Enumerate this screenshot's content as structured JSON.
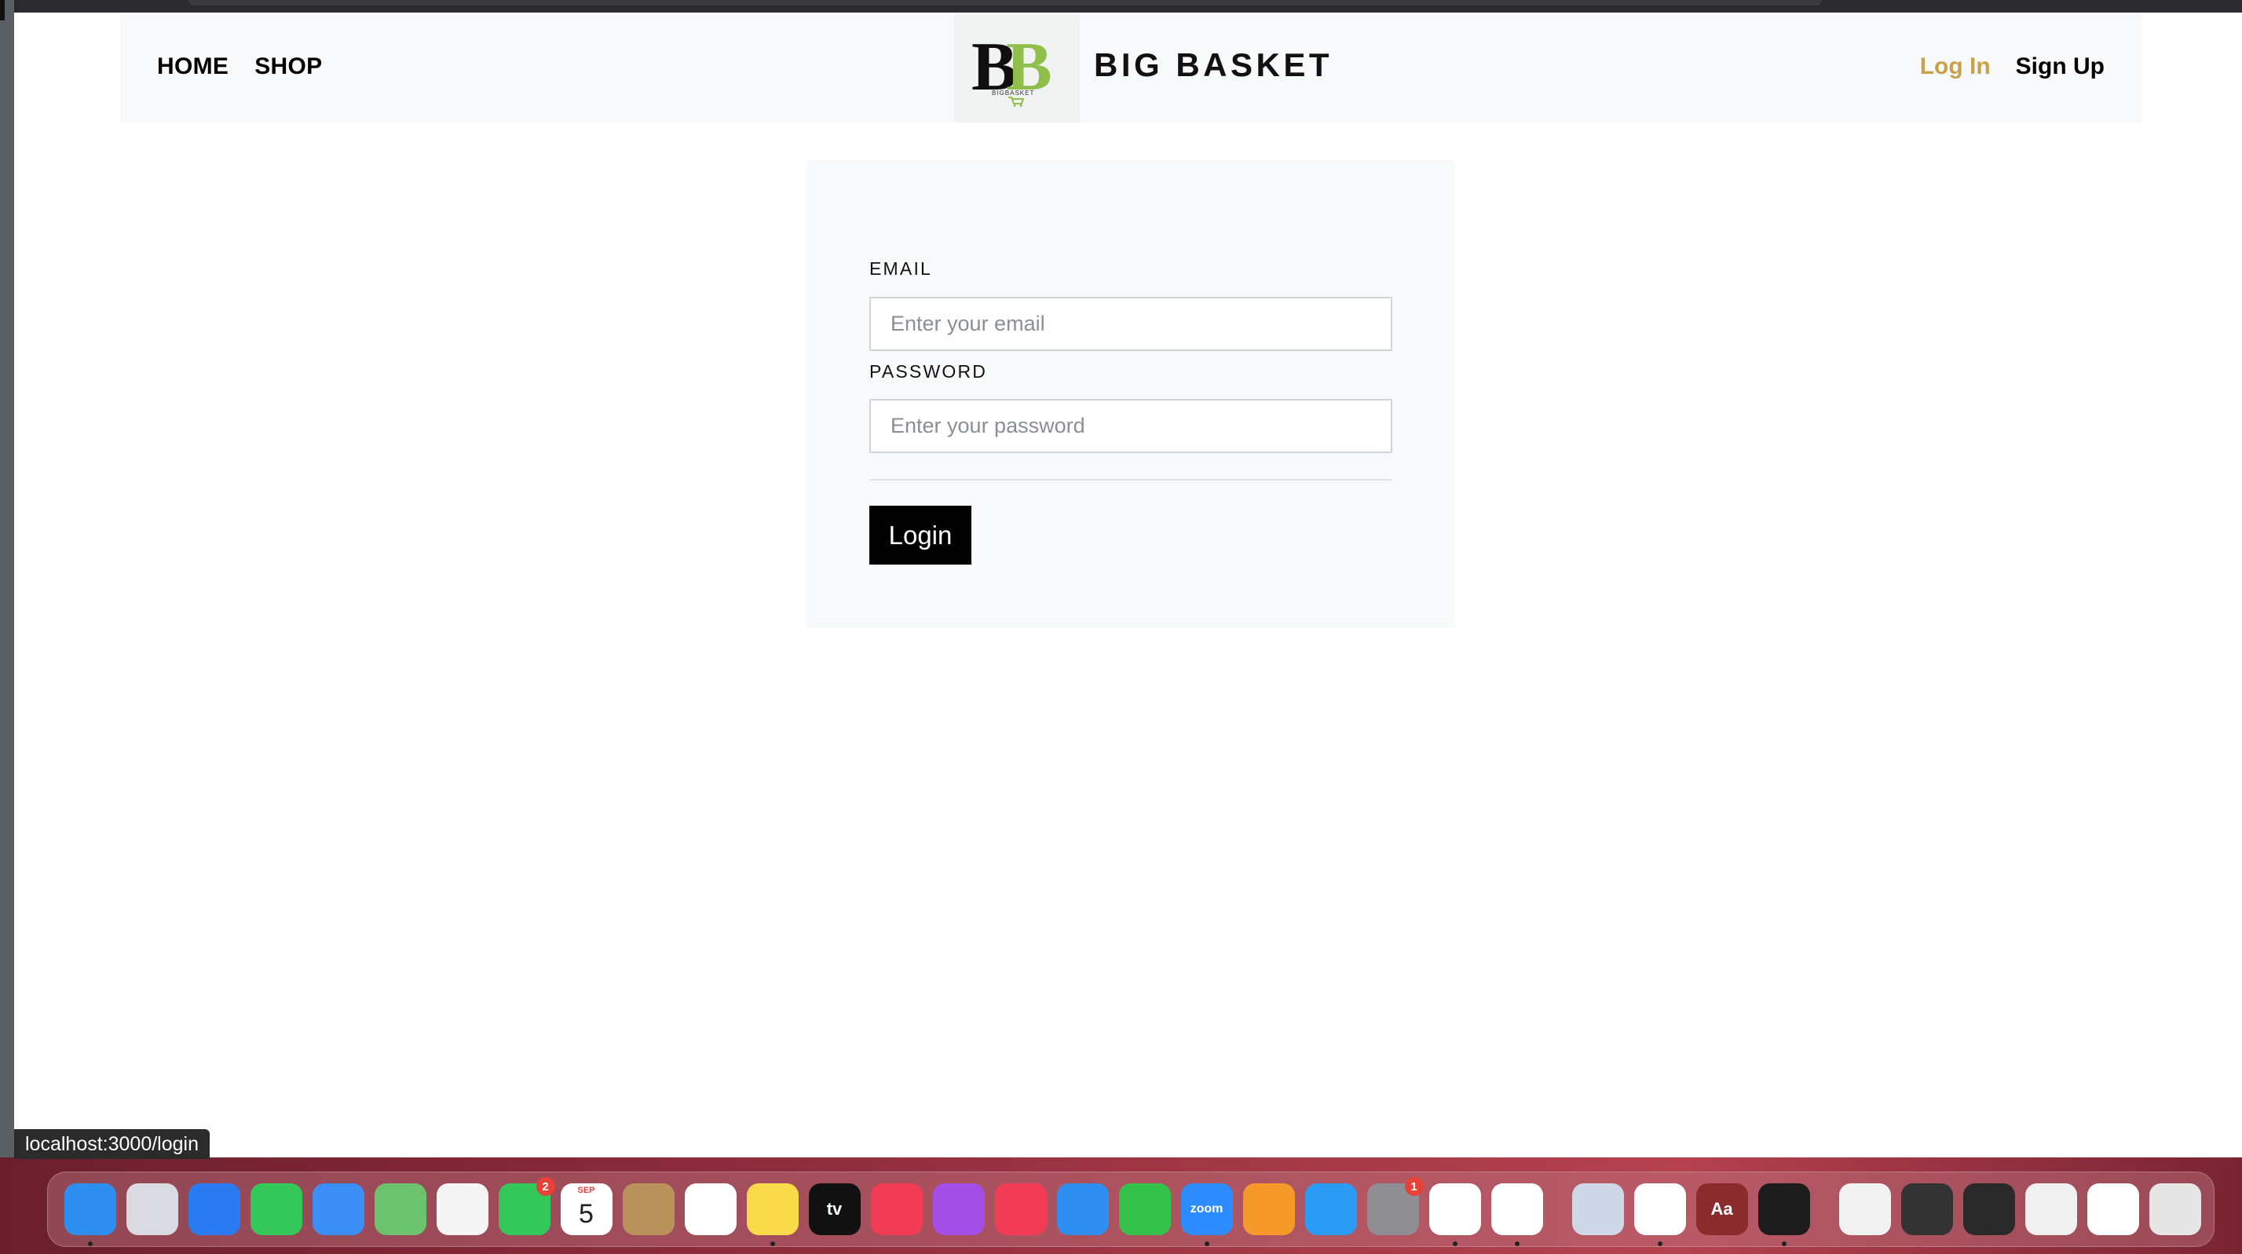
{
  "navbar": {
    "home_label": "HOME",
    "shop_label": "SHOP",
    "brand_name": "BIG BASKET",
    "logo_text": "BB",
    "logo_subtext": "BIGBASKET",
    "login_label": "Log In",
    "signup_label": "Sign Up",
    "login_color": "#c9a14a"
  },
  "form": {
    "email_label": "EMAIL",
    "email_placeholder": "Enter your email",
    "email_value": "",
    "password_label": "PASSWORD",
    "password_placeholder": "Enter your password",
    "password_value": "",
    "submit_label": "Login"
  },
  "status_bar": {
    "url": "localhost:3000/login"
  },
  "dock": {
    "apps": [
      {
        "name": "finder-icon",
        "color": "#2f8ff0",
        "running": true
      },
      {
        "name": "launchpad-icon",
        "color": "#d9dbe0"
      },
      {
        "name": "safari-icon",
        "color": "#2a7bf2"
      },
      {
        "name": "messages-icon",
        "color": "#34c759"
      },
      {
        "name": "mail-icon",
        "color": "#3a8ef5"
      },
      {
        "name": "maps-icon",
        "color": "#6bc46d"
      },
      {
        "name": "photos-icon",
        "color": "#f5f5f5"
      },
      {
        "name": "facetime-icon",
        "color": "#34c759",
        "badge": "2"
      },
      {
        "name": "calendar-icon",
        "color": "#ffffff",
        "label": "5",
        "sublabel": "SEP"
      },
      {
        "name": "contacts-icon",
        "color": "#b8925a"
      },
      {
        "name": "reminders-icon",
        "color": "#ffffff"
      },
      {
        "name": "notes-icon",
        "color": "#f7d94a",
        "running": true
      },
      {
        "name": "appletv-icon",
        "color": "#111111",
        "label": "tv"
      },
      {
        "name": "music-icon",
        "color": "#f23c55"
      },
      {
        "name": "podcasts-icon",
        "color": "#a44ee8"
      },
      {
        "name": "news-icon",
        "color": "#f23c55"
      },
      {
        "name": "keynote-icon",
        "color": "#2f8ff0"
      },
      {
        "name": "numbers-icon",
        "color": "#35c24a"
      },
      {
        "name": "zoom-icon",
        "color": "#2d8cff",
        "label": "zoom",
        "running": true
      },
      {
        "name": "pages-icon",
        "color": "#f59a2a"
      },
      {
        "name": "appstore-icon",
        "color": "#2a9cf5"
      },
      {
        "name": "system-preferences-icon",
        "color": "#8e8e93",
        "badge": "1"
      },
      {
        "name": "chrome-icon",
        "color": "#ffffff",
        "running": true
      },
      {
        "name": "slack-icon",
        "color": "#ffffff",
        "running": true
      }
    ],
    "apps_right": [
      {
        "name": "preview-icon",
        "color": "#cfd8e6"
      },
      {
        "name": "vscode-icon",
        "color": "#ffffff",
        "running": true
      },
      {
        "name": "dictionary-icon",
        "color": "#8c2b2b",
        "label": "Aa"
      },
      {
        "name": "terminal-icon",
        "color": "#1c1c1c",
        "running": true
      }
    ],
    "stacks": [
      {
        "name": "zip-file-icon",
        "color": "#f2f2f2"
      },
      {
        "name": "window-thumbnail-icon",
        "color": "#333333"
      },
      {
        "name": "window-thumbnail-icon",
        "color": "#2a2a2a"
      },
      {
        "name": "window-thumbnail-icon",
        "color": "#f0f0f0"
      },
      {
        "name": "window-thumbnail-icon",
        "color": "#ffffff"
      },
      {
        "name": "trash-icon",
        "color": "#e6e6e6"
      }
    ]
  }
}
